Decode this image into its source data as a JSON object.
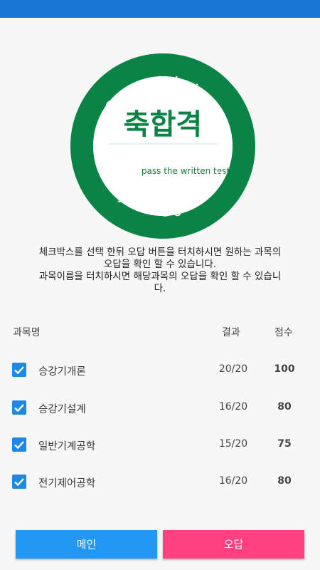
{
  "badge": {
    "arc_text": "Congratulations",
    "center_text": "축합격",
    "sub_text": "pass the written test",
    "bottom_arc_text": "LuckyLeeis@gmail.com",
    "ring_color": "#0a8445",
    "center_text_color": "#0a8445",
    "sub_text_color": "#1a7a3c"
  },
  "message": {
    "line1": "체크박스를 선택 한뒤 오답 버튼을 터치하시면 원하는 과목의",
    "line2": "오답을 확인 할 수 있습니다.",
    "line3": "과목이름을 터치하시면 해당과목의 오답을 확인 할 수 있습니",
    "line4": "다."
  },
  "table": {
    "headers": {
      "subject": "과목명",
      "result": "결과",
      "score": "점수"
    },
    "rows": [
      {
        "name": "승강기개론",
        "result": "20/20",
        "score": "100",
        "checked": true
      },
      {
        "name": "승강기설계",
        "result": "16/20",
        "score": "80",
        "checked": true
      },
      {
        "name": "일반기계공학",
        "result": "15/20",
        "score": "75",
        "checked": true
      },
      {
        "name": "전기제어공학",
        "result": "16/20",
        "score": "80",
        "checked": true
      }
    ]
  },
  "buttons": {
    "main_label": "메인",
    "wrong_label": "오답"
  },
  "colors": {
    "status_bar": "#1976d2",
    "checkbox": "#1e88e5",
    "main_button": "#2196f3",
    "wrong_button": "#ff4081"
  }
}
